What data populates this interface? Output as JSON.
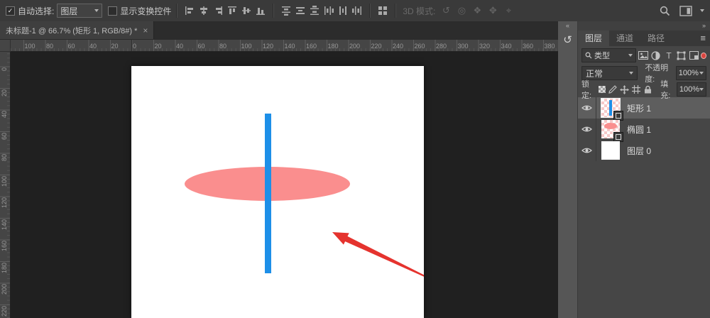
{
  "colors": {
    "accent_blue": "#1d8fe8",
    "shape_pink": "#fa8e8e",
    "arrow_red": "#e5332e",
    "panel_bg": "#464646",
    "selected_row": "#5e5e5e",
    "canvas_white": "#ffffff"
  },
  "options_bar": {
    "auto_select_label": "自动选择:",
    "auto_select_value": "图层",
    "show_transform_label": "显示变换控件",
    "mode_3d_label": "3D 模式:"
  },
  "tab": {
    "title": "未标题-1 @ 66.7% (矩形 1, RGB/8#) *",
    "close_icon": "×"
  },
  "rulers": {
    "h_labels": [
      "100",
      "80",
      "60",
      "40",
      "20",
      "0",
      "20",
      "40",
      "60",
      "80",
      "100",
      "120",
      "140",
      "160",
      "180",
      "200",
      "220",
      "240",
      "260",
      "280",
      "300",
      "320",
      "340",
      "360",
      "380"
    ],
    "v_labels": [
      "0",
      "20",
      "40",
      "60",
      "80",
      "100",
      "120",
      "140",
      "160",
      "180",
      "200",
      "220"
    ]
  },
  "panel": {
    "collapse_left_icon": "«",
    "collapse_right_icon": "»",
    "tabs": [
      {
        "label": "图层"
      },
      {
        "label": "通道"
      },
      {
        "label": "路径"
      }
    ],
    "menu_icon": "≡",
    "filter_label": "类型",
    "blend_mode_value": "正常",
    "opacity_label": "不透明度:",
    "opacity_value": "100%",
    "lock_label": "锁定:",
    "fill_label": "填充:",
    "fill_value": "100%",
    "layers": [
      {
        "name": "矩形 1"
      },
      {
        "name": "椭圆 1"
      },
      {
        "name": "图层 0"
      }
    ]
  },
  "icons": {
    "check": "✓",
    "orbit_3d": "↺",
    "roll_3d": "◎",
    "pan_3d": "❖",
    "slide_3d": "✥",
    "zoom_3d": "⌖",
    "history": "↺"
  }
}
